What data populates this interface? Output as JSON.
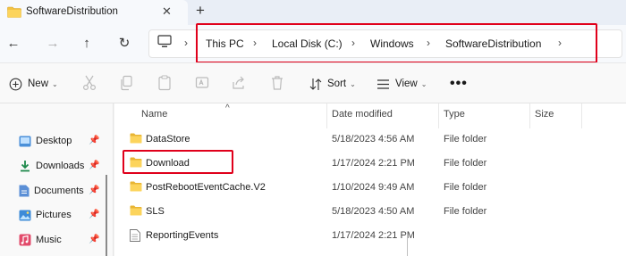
{
  "tab": {
    "title": "SoftwareDistribution",
    "close": "✕",
    "new": "+"
  },
  "nav_icons": {
    "back": "←",
    "forward": "→",
    "up": "↑",
    "refresh": "↻"
  },
  "breadcrumb": [
    {
      "label": "This PC"
    },
    {
      "label": "Local Disk (C:)"
    },
    {
      "label": "Windows"
    },
    {
      "label": "SoftwareDistribution"
    }
  ],
  "separator": "›",
  "toolbar": {
    "new_label": "New",
    "sort_label": "Sort",
    "view_label": "View",
    "more": "•••",
    "caret": "⌄",
    "icons": [
      "cut-icon",
      "copy-icon",
      "paste-icon",
      "rename-icon",
      "share-icon",
      "delete-icon"
    ]
  },
  "columns": {
    "name": "Name",
    "date": "Date modified",
    "type": "Type",
    "size": "Size",
    "sort_indicator": "^"
  },
  "sidebar": {
    "pin": "📌",
    "items": [
      {
        "label": "Desktop",
        "icon": "desktop-icon"
      },
      {
        "label": "Downloads",
        "icon": "downloads-icon"
      },
      {
        "label": "Documents",
        "icon": "documents-icon"
      },
      {
        "label": "Pictures",
        "icon": "pictures-icon"
      },
      {
        "label": "Music",
        "icon": "music-icon"
      }
    ]
  },
  "files": [
    {
      "name": "DataStore",
      "date": "5/18/2023 4:56 AM",
      "type": "File folder",
      "icon": "folder-icon"
    },
    {
      "name": "Download",
      "date": "1/17/2024 2:21 PM",
      "type": "File folder",
      "icon": "folder-icon"
    },
    {
      "name": "PostRebootEventCache.V2",
      "date": "1/10/2024 9:49 AM",
      "type": "File folder",
      "icon": "folder-icon"
    },
    {
      "name": "SLS",
      "date": "5/18/2023 4:50 AM",
      "type": "File folder",
      "icon": "folder-icon"
    },
    {
      "name": "ReportingEvents",
      "date": "1/17/2024 2:21 PM",
      "type": "",
      "icon": "text-file-icon"
    }
  ],
  "colors": {
    "highlight_border": "#e0001b",
    "folder": "#f3c243",
    "tab_bar": "#e9eef6"
  }
}
